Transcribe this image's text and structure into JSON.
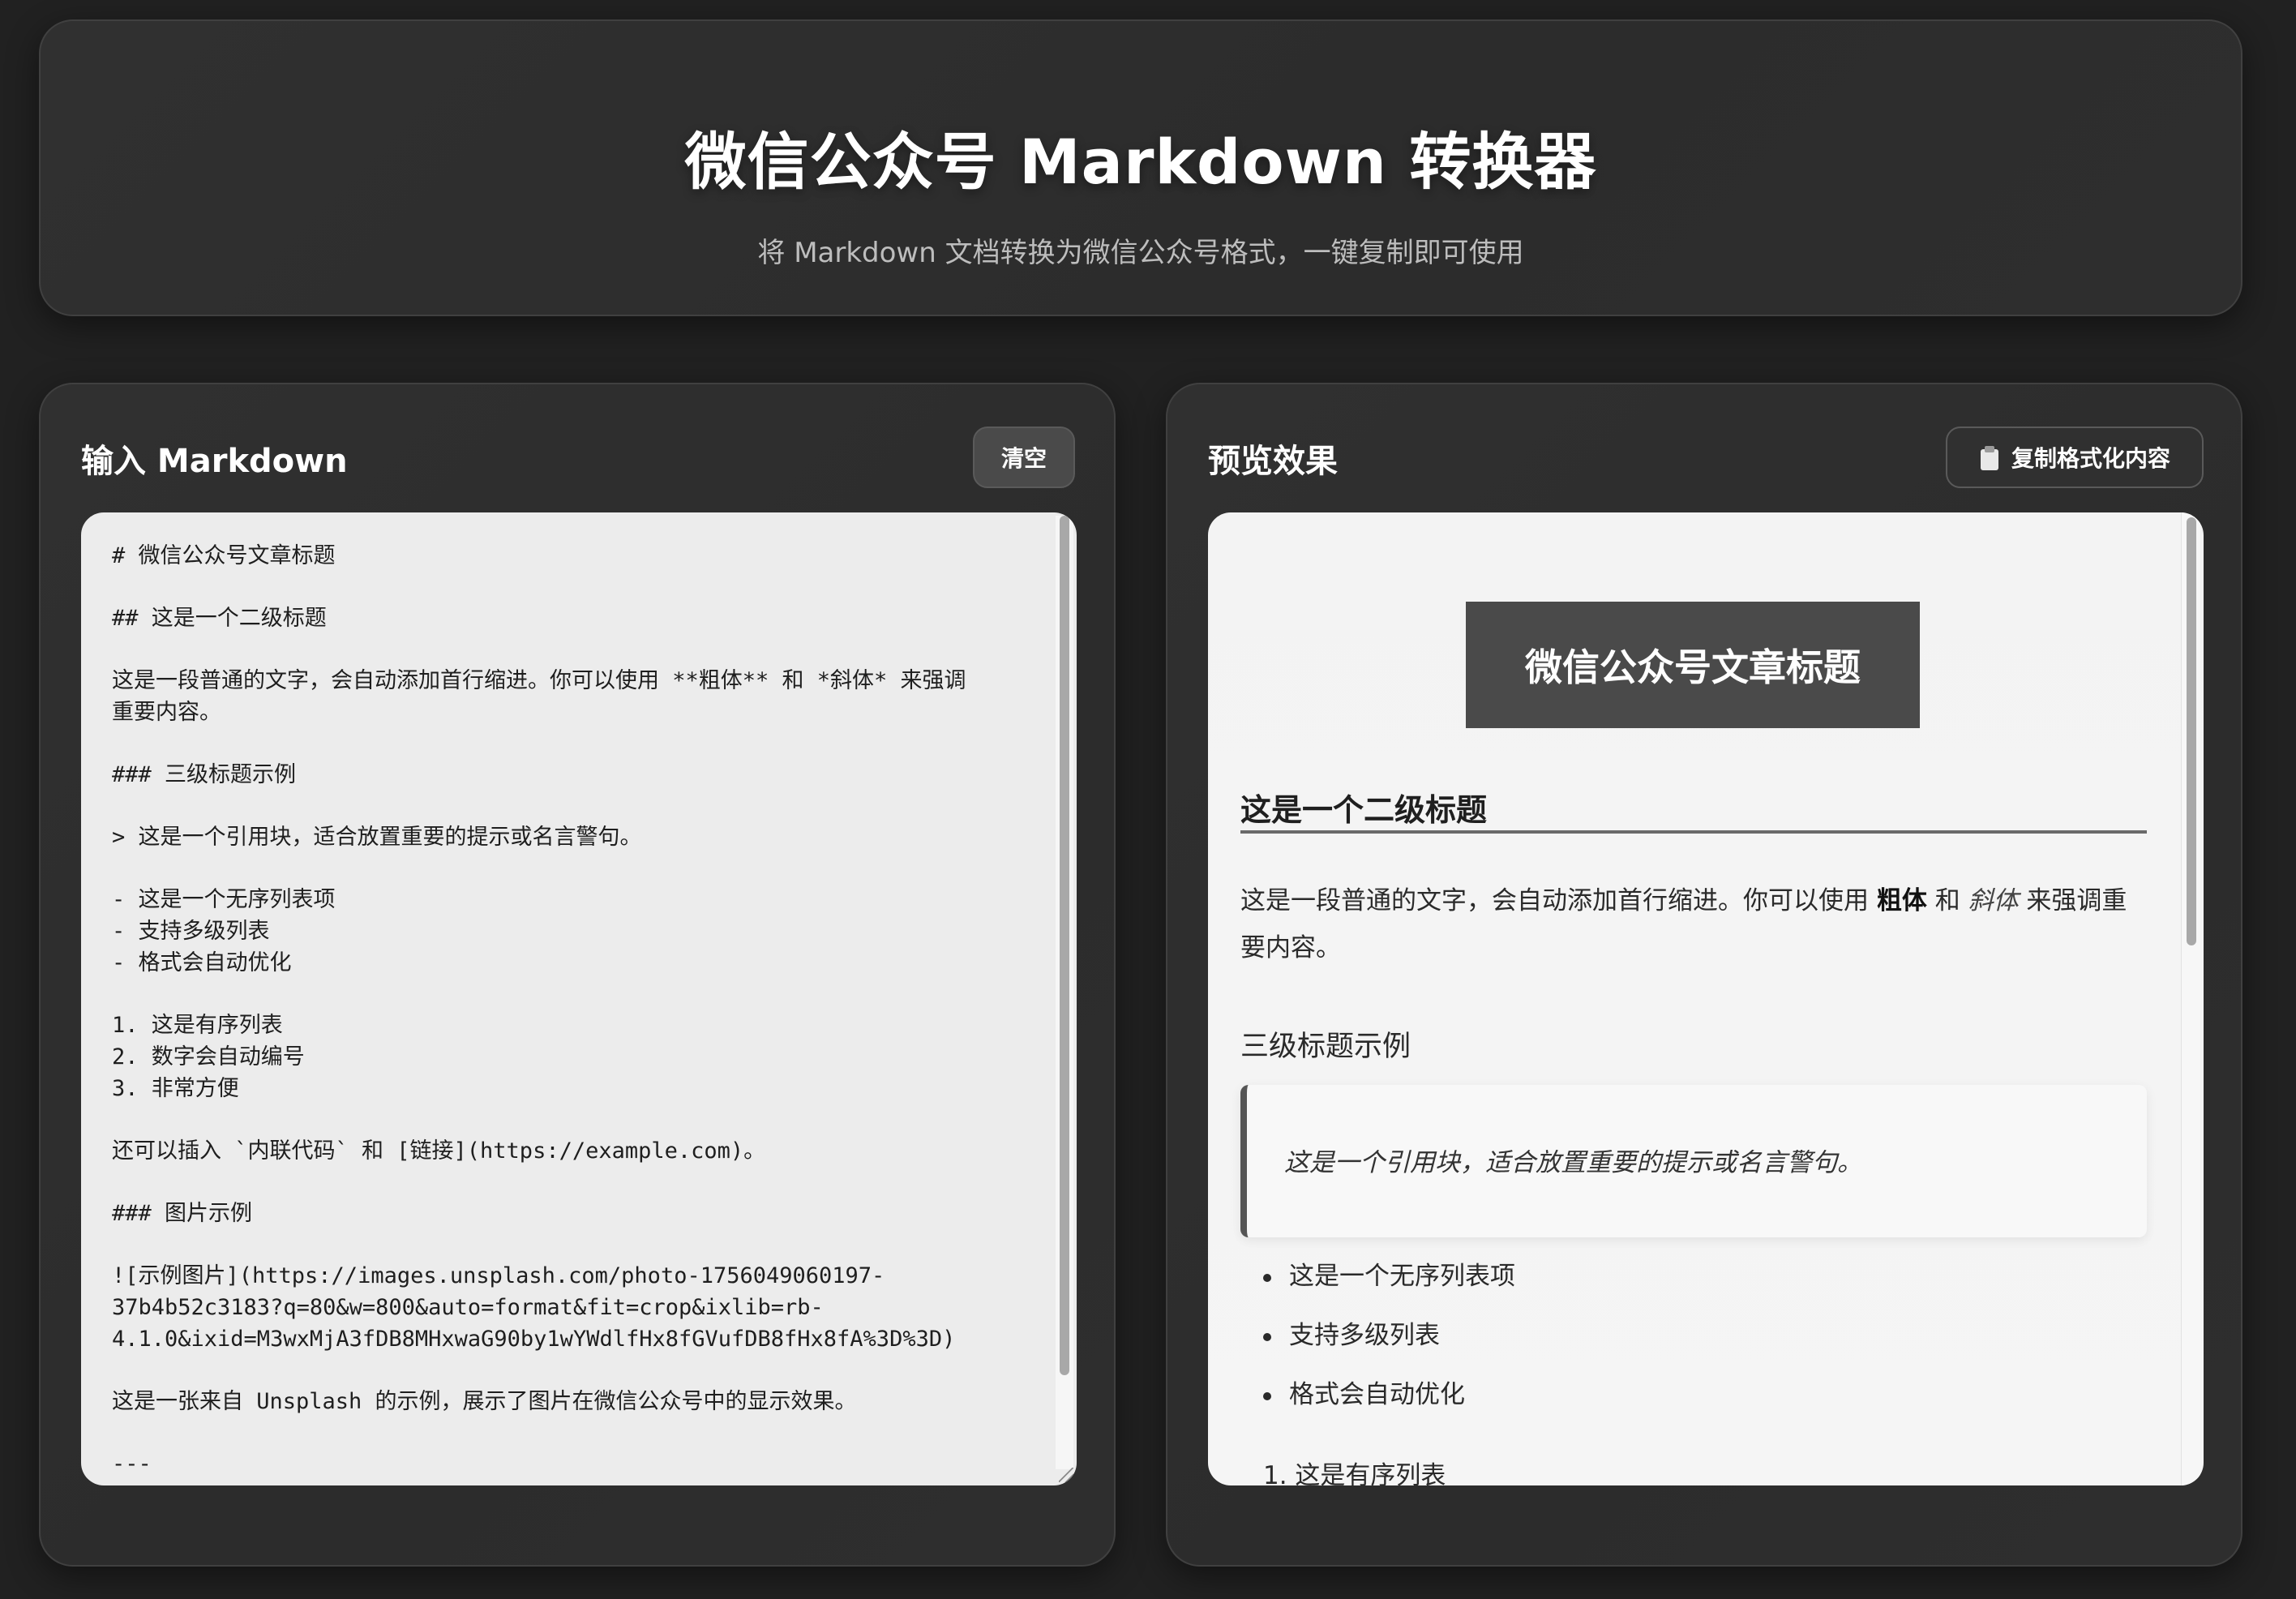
{
  "header": {
    "title": "微信公众号 Markdown 转换器",
    "subtitle": "将 Markdown 文档转换为微信公众号格式，一键复制即可使用"
  },
  "input_panel": {
    "title": "输入 Markdown",
    "clear_label": "清空",
    "lines": [
      "# 微信公众号文章标题",
      "",
      "## 这是一个二级标题",
      "",
      "这是一段普通的文字，会自动添加首行缩进。你可以使用 **粗体** 和 *斜体* 来强调",
      "重要内容。",
      "",
      "### 三级标题示例",
      "",
      "> 这是一个引用块，适合放置重要的提示或名言警句。",
      "",
      "- 这是一个无序列表项",
      "- 支持多级列表",
      "- 格式会自动优化",
      "",
      "1. 这是有序列表",
      "2. 数字会自动编号",
      "3. 非常方便",
      "",
      "还可以插入 `内联代码` 和 [链接](https://example.com)。",
      "",
      "### 图片示例",
      "",
      "![示例图片](https://images.unsplash.com/photo-1756049060197-",
      "37b4b52c3183?q=80&w=800&auto=format&fit=crop&ixlib=rb-",
      "4.1.0&ixid=M3wxMjA3fDB8MHxwaG90by1wYWdlfHx8fGVufDB8fHx8fA%3D%3D)",
      "",
      "这是一张来自 Unsplash 的示例，展示了图片在微信公众号中的显示效果。",
      "",
      "---"
    ]
  },
  "preview_panel": {
    "title": "预览效果",
    "copy_label": "复制格式化内容",
    "copy_icon": "clipboard-icon",
    "h1": "微信公众号文章标题",
    "h2": "这是一个二级标题",
    "para_start": "这是一段普通的文字，会自动添加首行缩进。你可以使用 ",
    "para_bold": "粗体",
    "para_and": " 和 ",
    "para_italic": "斜体",
    "para_end": " 来强调重要内容。",
    "h3": "三级标题示例",
    "quote": "这是一个引用块，适合放置重要的提示或名言警句。",
    "ul": [
      "这是一个无序列表项",
      "支持多级列表",
      "格式会自动优化"
    ],
    "ol_first": "1. 这是有序列表"
  },
  "colors": {
    "background": "#212121",
    "card": "#2e2e2e",
    "h1_block": "#4a4a4a",
    "editor_bg": "#ececec",
    "preview_bg": "#f4f4f4"
  }
}
